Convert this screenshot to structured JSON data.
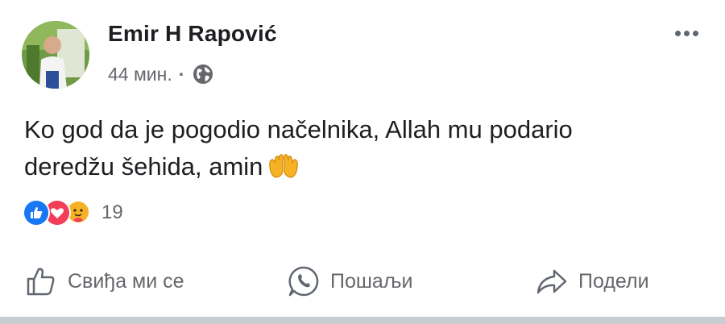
{
  "post": {
    "author": "Emir H Rapović",
    "time": "44 мин.",
    "separator": "·",
    "privacy_icon": "globe-icon",
    "text_line1": "Ko god da je pogodio načelnika, Allah mu podario",
    "text_line2": "deredžu šehida, amin",
    "text_emoji": "open-hands-emoji",
    "reactions": [
      "like-reaction",
      "love-reaction",
      "care-reaction"
    ],
    "reaction_count": "19"
  },
  "actions": {
    "like_label": "Свиђа ми се",
    "send_label": "Пошаљи",
    "share_label": "Подели"
  },
  "colors": {
    "text": "#1c1e21",
    "secondary": "#65676b",
    "like_blue": "#1877f2",
    "love_red": "#f33e58",
    "care_yellow": "#f7b125"
  }
}
